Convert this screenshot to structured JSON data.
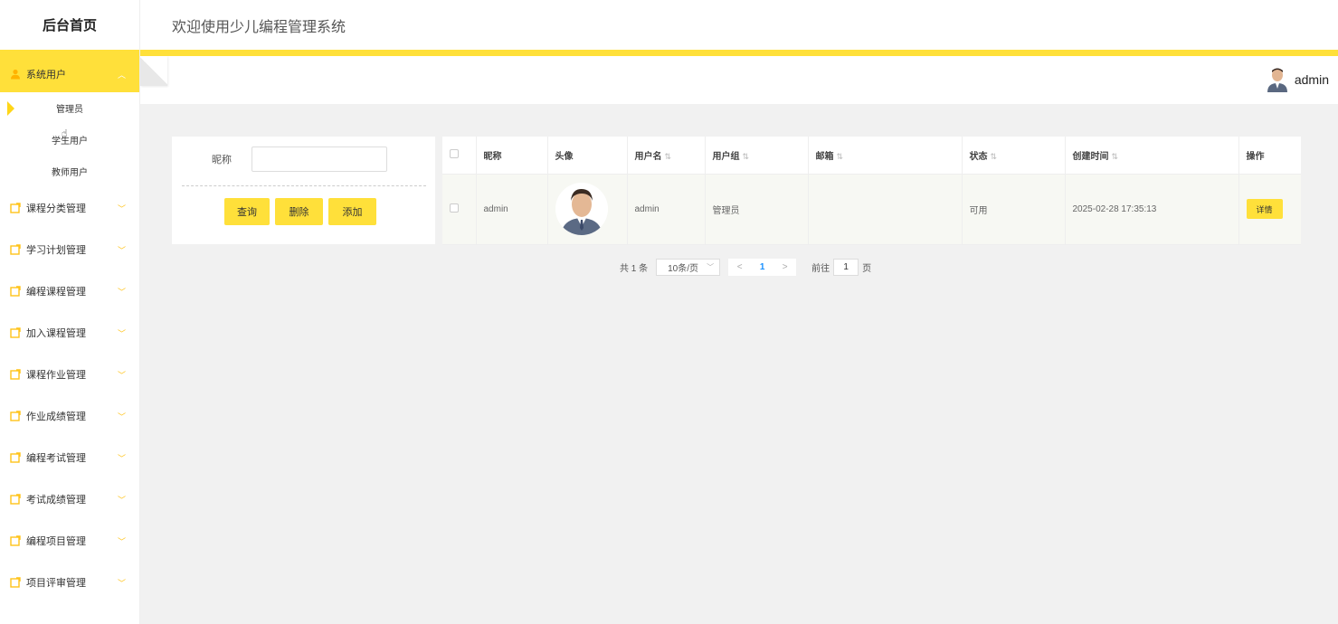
{
  "sidebar": {
    "logo": "后台首页",
    "groups": [
      {
        "label": "系统用户",
        "icon": "user-icon",
        "expanded": true,
        "items": [
          {
            "label": "管理员",
            "active": true
          },
          {
            "label": "学生用户"
          },
          {
            "label": "教师用户"
          }
        ]
      },
      {
        "label": "课程分类管理",
        "icon": "edit-icon"
      },
      {
        "label": "学习计划管理",
        "icon": "edit-icon"
      },
      {
        "label": "编程课程管理",
        "icon": "edit-icon"
      },
      {
        "label": "加入课程管理",
        "icon": "edit-icon"
      },
      {
        "label": "课程作业管理",
        "icon": "edit-icon"
      },
      {
        "label": "作业成绩管理",
        "icon": "edit-icon"
      },
      {
        "label": "编程考试管理",
        "icon": "edit-icon"
      },
      {
        "label": "考试成绩管理",
        "icon": "edit-icon"
      },
      {
        "label": "编程项目管理",
        "icon": "edit-icon"
      },
      {
        "label": "项目评审管理",
        "icon": "edit-icon"
      }
    ]
  },
  "header": {
    "title": "欢迎使用少儿编程管理系统"
  },
  "user": {
    "name": "admin"
  },
  "search": {
    "label": "昵称",
    "value": "",
    "query_label": "查询",
    "delete_label": "删除",
    "add_label": "添加"
  },
  "table": {
    "columns": [
      "昵称",
      "头像",
      "用户名",
      "用户组",
      "邮箱",
      "状态",
      "创建时间",
      "操作"
    ],
    "rows": [
      {
        "nickname": "admin",
        "username": "admin",
        "group": "管理员",
        "email": "",
        "status": "可用",
        "created": "2025-02-28 17:35:13",
        "action": "详情"
      }
    ]
  },
  "pagination": {
    "total": "共 1 条",
    "page_size": "10条/页",
    "prev": "<",
    "current": "1",
    "next": ">",
    "goto_label": "前往",
    "goto_value": "1",
    "goto_suffix": "页"
  },
  "colors": {
    "accent": "#ffe03a",
    "link": "#1890ff",
    "content_bg": "#f1f1f1"
  }
}
